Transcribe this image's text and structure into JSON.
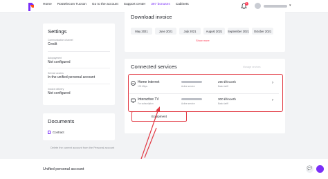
{
  "nav": {
    "links": [
      "Home",
      "Rostelecom Tucson",
      "Go to the account",
      "Support center"
    ],
    "bonus": "397 bonuses",
    "cabinets": "Cabinets",
    "notifications_count": "1",
    "accent_color": "#7b2ff7"
  },
  "settings": {
    "title": "Settings",
    "fields": [
      {
        "label": "Communication channel",
        "value": "Credit"
      },
      {
        "label": "Autopayment",
        "value": "Not configured"
      },
      {
        "label": "Service access",
        "value": "In the unified personal account"
      },
      {
        "label": "Invoice delivery",
        "value": "Not configured"
      }
    ]
  },
  "documents": {
    "title": "Documents",
    "contract": "Contract",
    "delete_link": "Delete the current account from the Personal account"
  },
  "invoice": {
    "title": "Download invoice",
    "months": [
      "May 2021",
      "June 2021",
      "July 2021",
      "August 2021",
      "September 2021",
      "October 2021"
    ],
    "show_more": "Show more"
  },
  "services": {
    "title": "Connected services",
    "manage_link": "Manage services",
    "items": [
      {
        "name": "Home internet",
        "sub": "100 Mbps",
        "status": "Active service",
        "price": "290 ₽/month",
        "tariff": "Basic tariff",
        "icon": "router-icon"
      },
      {
        "name": "Interactive TV",
        "sub": "For subscription",
        "status": "Active service",
        "price": "300 ₽/month",
        "tariff": "Basic tariff",
        "icon": "tv-icon"
      }
    ],
    "equipment_button": "Equipment",
    "highlight_color": "#e23b45"
  },
  "footer": {
    "text": "Unified personal account"
  }
}
